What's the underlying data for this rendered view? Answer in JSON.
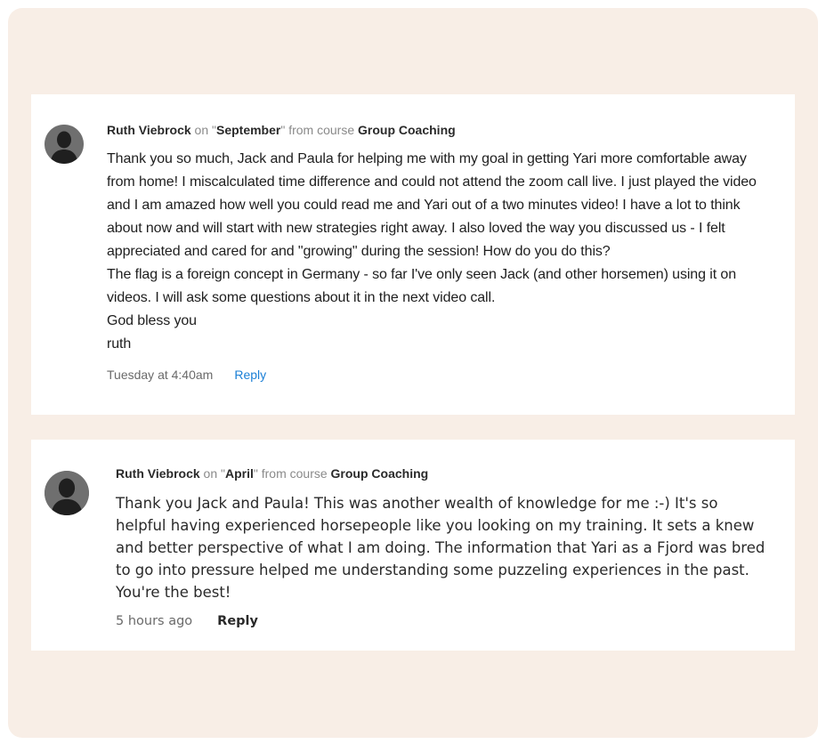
{
  "comments": [
    {
      "author": "Ruth Viebrock",
      "on_text": " on \"",
      "lesson": "September",
      "from_text": "\" from course ",
      "course": "Group Coaching",
      "body": "Thank you so much, Jack and Paula for helping me with my goal in getting Yari more comfortable away from home! I miscalculated time difference and could not attend the zoom call live. I just played the video and I am amazed how well you could read me and Yari out of a two minutes video! I have a lot to think about now and will start with new strategies right away. I also loved the way you discussed us - I felt appreciated and cared for and \"growing\" during the session! How do you do this?\nThe flag is a foreign concept in Germany - so far I've only seen Jack (and other horsemen) using it on videos. I will ask some questions about it in the next video call.\nGod bless you\nruth",
      "time": "Tuesday at 4:40am",
      "reply_label": "Reply",
      "avatar_icon": "user-silhouette-icon"
    },
    {
      "author": "Ruth Viebrock",
      "on_text": " on \"",
      "lesson": "April",
      "from_text": "\" from course ",
      "course": "Group Coaching",
      "body": "Thank you Jack and Paula! This was another wealth of knowledge for me :-) It's so helpful having experienced horsepeople like you looking on my training. It sets a knew and better perspective of what I am doing. The information that Yari as a Fjord was bred to go into pressure helped me understanding some puzzeling experiences in the past. You're the best!",
      "time": "5 hours ago",
      "reply_label": "Reply",
      "avatar_icon": "user-silhouette-icon"
    }
  ],
  "colors": {
    "background": "#f8eee6",
    "card": "#ffffff",
    "link_blue": "#1a7fd6",
    "avatar": "#6f6f6f"
  }
}
